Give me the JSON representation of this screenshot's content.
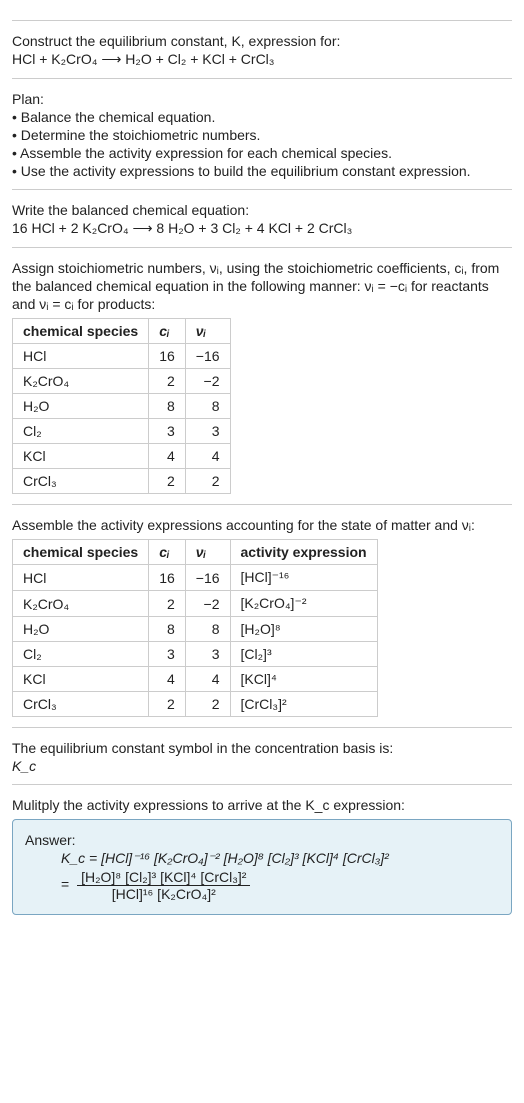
{
  "section1": {
    "title": "Construct the equilibrium constant, K, expression for:",
    "eq": "HCl + K₂CrO₄  ⟶  H₂O + Cl₂ + KCl + CrCl₃"
  },
  "section2": {
    "title": "Plan:",
    "bullets": [
      "• Balance the chemical equation.",
      "• Determine the stoichiometric numbers.",
      "• Assemble the activity expression for each chemical species.",
      "• Use the activity expressions to build the equilibrium constant expression."
    ]
  },
  "section3": {
    "title": "Write the balanced chemical equation:",
    "eq": "16 HCl + 2 K₂CrO₄  ⟶  8 H₂O + 3 Cl₂ + 4 KCl + 2 CrCl₃"
  },
  "section4": {
    "intro1": "Assign stoichiometric numbers, νᵢ, using the stoichiometric coefficients, cᵢ, from",
    "intro2": "the balanced chemical equation in the following manner: νᵢ = −cᵢ for reactants",
    "intro3": "and νᵢ = cᵢ for products:",
    "headers": [
      "chemical species",
      "cᵢ",
      "νᵢ"
    ],
    "rows": [
      {
        "sp": "HCl",
        "c": "16",
        "v": "−16"
      },
      {
        "sp": "K₂CrO₄",
        "c": "2",
        "v": "−2"
      },
      {
        "sp": "H₂O",
        "c": "8",
        "v": "8"
      },
      {
        "sp": "Cl₂",
        "c": "3",
        "v": "3"
      },
      {
        "sp": "KCl",
        "c": "4",
        "v": "4"
      },
      {
        "sp": "CrCl₃",
        "c": "2",
        "v": "2"
      }
    ]
  },
  "section5": {
    "intro": "Assemble the activity expressions accounting for the state of matter and νᵢ:",
    "headers": [
      "chemical species",
      "cᵢ",
      "νᵢ",
      "activity expression"
    ],
    "rows": [
      {
        "sp": "HCl",
        "c": "16",
        "v": "−16",
        "a": "[HCl]⁻¹⁶"
      },
      {
        "sp": "K₂CrO₄",
        "c": "2",
        "v": "−2",
        "a": "[K₂CrO₄]⁻²"
      },
      {
        "sp": "H₂O",
        "c": "8",
        "v": "8",
        "a": "[H₂O]⁸"
      },
      {
        "sp": "Cl₂",
        "c": "3",
        "v": "3",
        "a": "[Cl₂]³"
      },
      {
        "sp": "KCl",
        "c": "4",
        "v": "4",
        "a": "[KCl]⁴"
      },
      {
        "sp": "CrCl₃",
        "c": "2",
        "v": "2",
        "a": "[CrCl₃]²"
      }
    ]
  },
  "section6": {
    "line1": "The equilibrium constant symbol in the concentration basis is:",
    "line2": "K_c"
  },
  "section7": {
    "intro": "Mulitply the activity expressions to arrive at the K_c expression:",
    "answer_label": "Answer:",
    "kc_line": "K_c = [HCl]⁻¹⁶ [K₂CrO₄]⁻² [H₂O]⁸ [Cl₂]³ [KCl]⁴ [CrCl₃]²",
    "frac_num": "[H₂O]⁸ [Cl₂]³ [KCl]⁴ [CrCl₃]²",
    "frac_den": "[HCl]¹⁶ [K₂CrO₄]²",
    "equals": "="
  }
}
